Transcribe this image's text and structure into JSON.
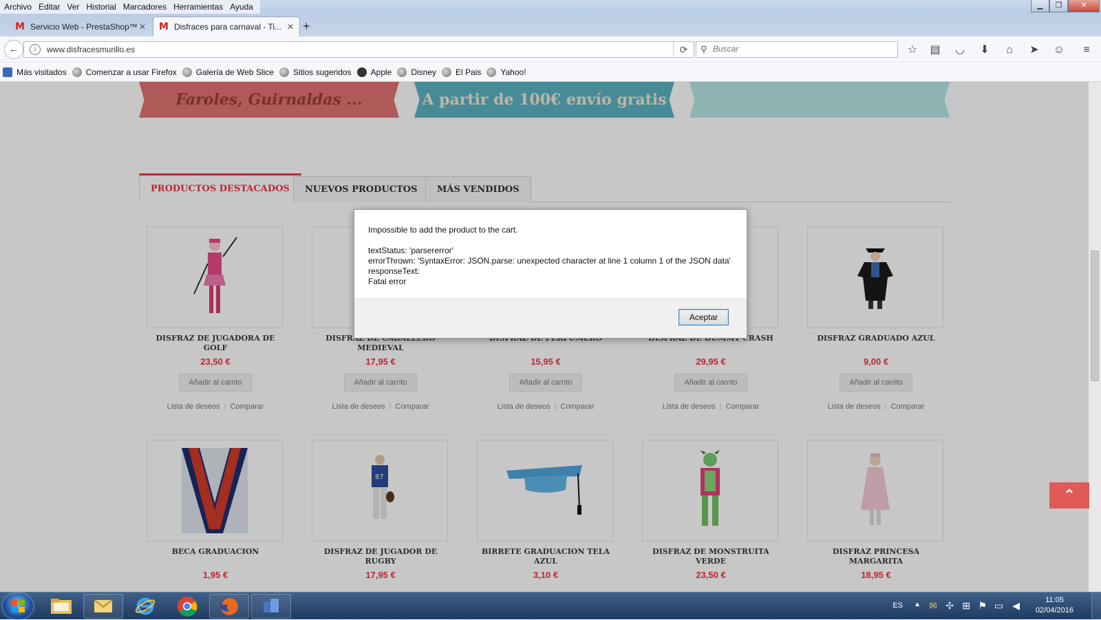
{
  "menu": {
    "items": [
      "Archivo",
      "Editar",
      "Ver",
      "Historial",
      "Marcadores",
      "Herramientas",
      "Ayuda"
    ]
  },
  "window_buttons": {
    "minimize": "▁",
    "maximize": "❐",
    "close": "✕"
  },
  "tabs": [
    {
      "title": "Servicio Web - PrestaShop™",
      "favicon": "M"
    },
    {
      "title": "Disfraces para carnaval - Ti...",
      "favicon": "M"
    }
  ],
  "new_tab_label": "+",
  "navigation": {
    "url": "www.disfracesmurillo.es",
    "search_placeholder": "Buscar"
  },
  "bookmarks": [
    "Más visitados",
    "Comenzar a usar Firefox",
    "Galería de Web Slice",
    "Sitios sugeridos",
    "Apple",
    "Disney",
    "El Pais",
    "Yahoo!"
  ],
  "banners": {
    "left": "Faroles, Guirnaldas ...",
    "middle": "A partir de 100€ envío gratis"
  },
  "product_tabs": [
    "PRODUCTOS DESTACADOS",
    "NUEVOS PRODUCTOS",
    "MÁS VENDIDOS"
  ],
  "product_common": {
    "add_to_cart": "Añadir al carrito",
    "wishlist": "Lista de deseos",
    "compare": "Comparar"
  },
  "products_row1": [
    {
      "name": "DISFRAZ DE JUGADORA DE GOLF",
      "price": "23,50 €"
    },
    {
      "name": "DISFRAZ DE CABALLERO MEDIEVAL",
      "price": "17,95 €"
    },
    {
      "name": "DISFRAZ DE PERFUMERO",
      "price": "15,95 €"
    },
    {
      "name": "DISFRAZ DE DUMMY CRASH",
      "price": "29,95 €"
    },
    {
      "name": "DISFRAZ GRADUADO AZUL",
      "price": "9,00 €"
    }
  ],
  "products_row2": [
    {
      "name": "BECA GRADUACION",
      "price": "1,95 €"
    },
    {
      "name": "DISFRAZ DE JUGADOR DE RUGBY",
      "price": "17,95 €"
    },
    {
      "name": "BIRRETE GRADUACION TELA AZUL",
      "price": "3,10 €"
    },
    {
      "name": "DISFRAZ DE MONSTRUITA VERDE",
      "price": "23,50 €"
    },
    {
      "name": "DISFRAZ PRINCESA MARGARITA",
      "price": "18,95 €"
    }
  ],
  "dialog": {
    "message": "Impossible to add the product to the cart.\n\ntextStatus: 'parsererror'\nerrorThrown: 'SyntaxError: JSON.parse: unexpected character at line 1 column 1 of the JSON data'\nresponseText:\nFatal error",
    "ok_button": "Aceptar"
  },
  "scroll_to_top": "⌃",
  "taskbar": {
    "language": "ES",
    "time": "11:05",
    "date": "02/04/2016"
  },
  "colors": {
    "accent_red": "#f13340",
    "banner_red": "#e07373",
    "banner_teal": "#5cb3c4",
    "banner_light": "#b6e6e6"
  }
}
